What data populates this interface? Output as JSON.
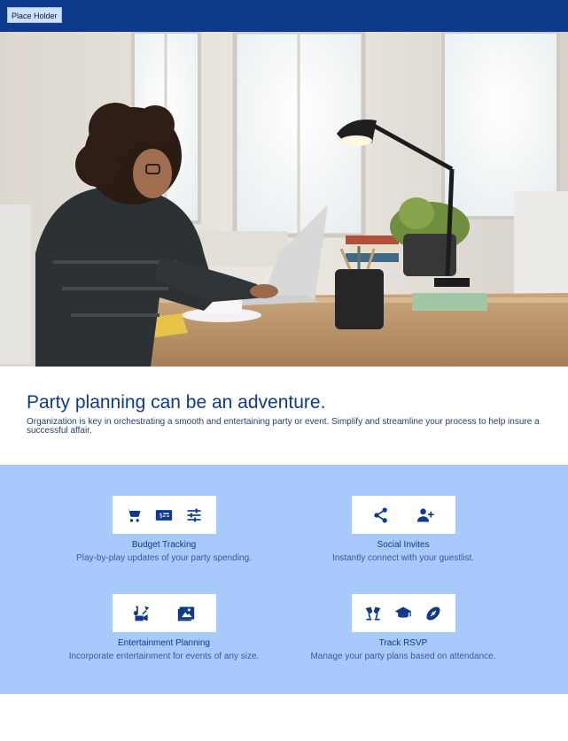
{
  "header": {
    "placeholder_button": "Place Holder",
    "background_color": "#0d3a8b"
  },
  "hero": {
    "image_description_icon": "hero-photo"
  },
  "intro": {
    "title": "Party planning can be an adventure.",
    "description": "Organization is key in orchestrating a smooth and entertaining party or event. Simplify and streamline your process to help insure a successful affair."
  },
  "features": [
    {
      "title": "Budget Tracking",
      "description": "Play-by-play updates of your party spending.",
      "icons": [
        "cart-icon",
        "money-bill-icon",
        "sliders-icon"
      ]
    },
    {
      "title": "Social Invites",
      "description": "Instantly connect with your guestlist.",
      "icons": [
        "share-icon",
        "add-user-icon"
      ]
    },
    {
      "title": "Entertainment Planning",
      "description": "Incorporate entertainment for events of any size.",
      "icons": [
        "music-video-icon",
        "photo-album-icon"
      ]
    },
    {
      "title": "Track RSVP",
      "description": "Manage your party plans based on attendance.",
      "icons": [
        "toast-glasses-icon",
        "graduation-cap-icon",
        "football-icon"
      ]
    }
  ],
  "colors": {
    "brand": "#0d3a8b",
    "features_background": "#a8c9fb",
    "accent_text": "#3c5b8b"
  }
}
